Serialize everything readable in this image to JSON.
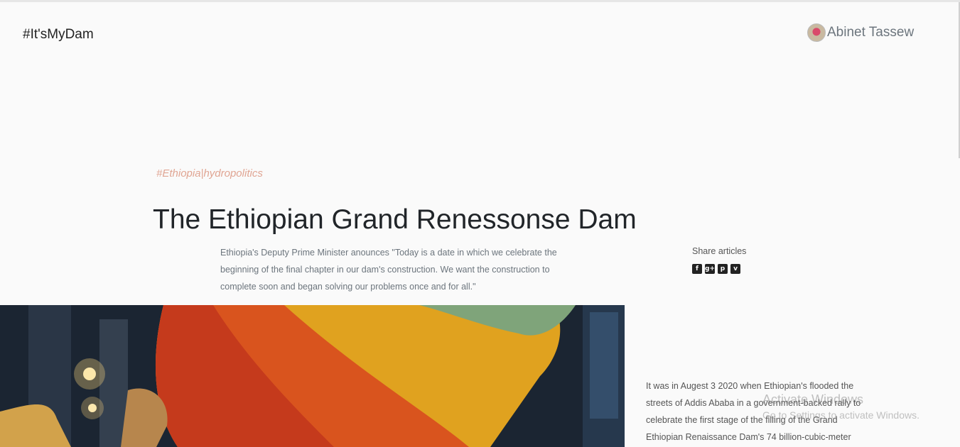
{
  "header": {
    "brand": "#It'sMyDam",
    "author_name": "Abinet Tassew"
  },
  "article": {
    "tag": "#Ethiopia|hydropolitics",
    "title": "The Ethiopian Grand Renessonse Dam",
    "lead": "Ethiopia's Deputy Prime Minister anounces \"Today is a date in which we celebrate the beginning of the final chapter in our dam's construction. We want the construction to complete soon and began solving our problems once and for all.\"",
    "body": "It was in Augest 3 2020 when Ethiopian's flooded the streets of Addis Ababa in a government-backed rally to celebrate the first stage of the filling of the Grand Ethiopian Renaissance Dam's 74 billion-cubic-meter"
  },
  "share": {
    "label": "Share articles",
    "icons": [
      "facebook-icon",
      "google-plus-icon",
      "pinterest-icon",
      "vimeo-icon"
    ]
  },
  "watermark": {
    "line1": "Activate Windows",
    "line2": "Go to Settings to activate Windows."
  },
  "colors": {
    "background": "#fafafa",
    "tag": "#e0a593",
    "muted_text": "#6c757d"
  }
}
